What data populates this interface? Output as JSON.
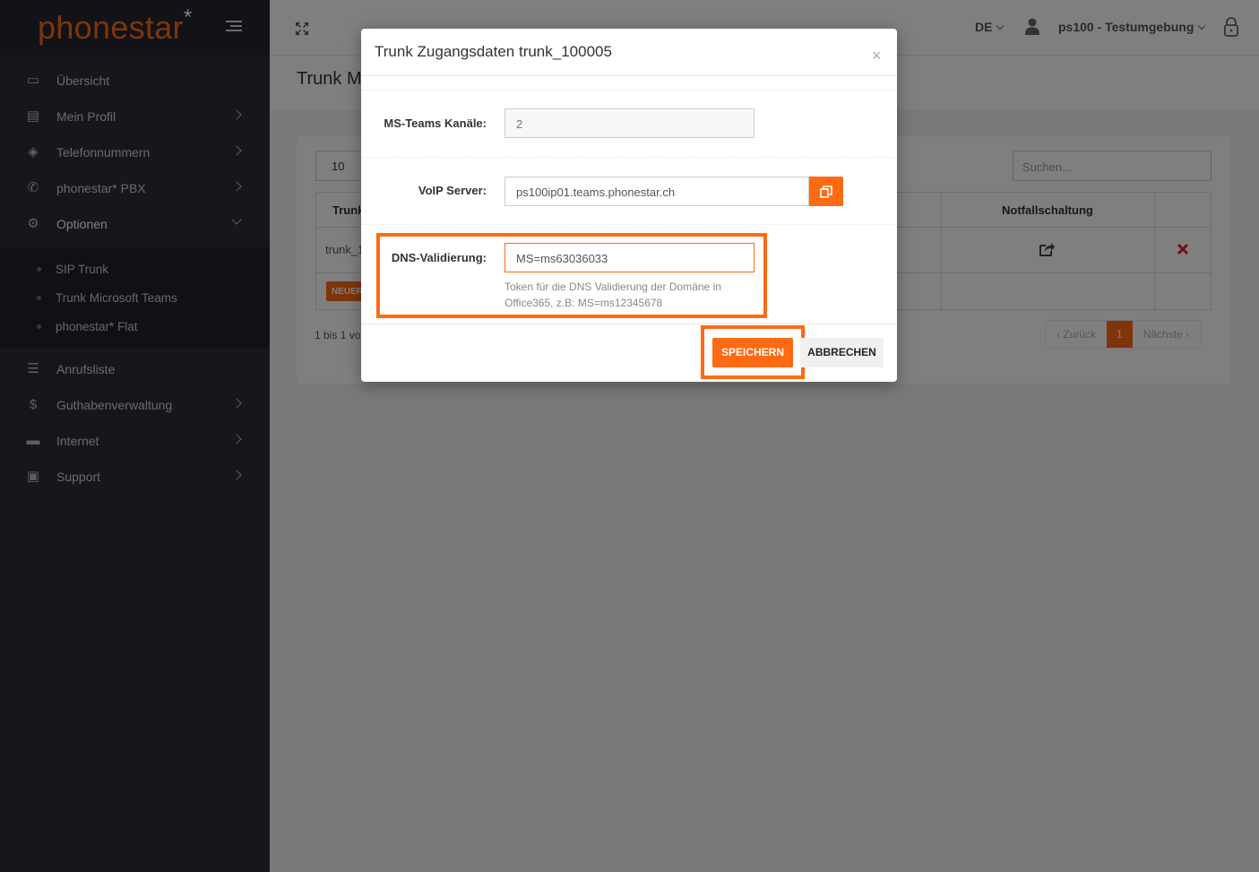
{
  "sidebar": {
    "logo": {
      "text": "phonestar",
      "mark": "*"
    },
    "items": [
      {
        "label": "Übersicht",
        "icon": "dashboard-icon"
      },
      {
        "label": "Mein Profil",
        "icon": "document-icon"
      },
      {
        "label": "Telefonnummern",
        "icon": "tags-icon"
      },
      {
        "label": "phonestar* PBX",
        "icon": "phone-icon"
      },
      {
        "label": "Optionen",
        "icon": "cogs-icon"
      },
      {
        "label": "Anrufsliste",
        "icon": "list-icon"
      },
      {
        "label": "Guthabenverwaltung",
        "icon": "dollar-icon"
      },
      {
        "label": "Internet",
        "icon": "laptop-icon"
      },
      {
        "label": "Support",
        "icon": "briefcase-icon"
      }
    ],
    "subitems": [
      {
        "label": "SIP Trunk"
      },
      {
        "label": "Trunk Microsoft Teams"
      },
      {
        "label": "phonestar* Flat"
      }
    ]
  },
  "header": {
    "lang": "DE",
    "user": "ps100 - Testumgebung"
  },
  "page": {
    "title": "Trunk M",
    "length_value": "10",
    "search_placeholder": "Suchen...",
    "col_trunk": "Trunk",
    "col_notfall": "Notfallschaltung",
    "row_trunk": "trunk_1",
    "new_badge": "NEUER",
    "info": "1 bis 1 vo",
    "pager": {
      "prev": "Zurück",
      "current": "1",
      "next": "Nächste"
    }
  },
  "modal": {
    "title": "Trunk Zugangsdaten trunk_100005",
    "close": "×",
    "fields": {
      "channels_label": "MS-Teams Kanäle:",
      "channels_value": "2",
      "voip_label": "VoIP Server:",
      "voip_value": "ps100ip01.teams.phonestar.ch",
      "dns_label": "DNS-Validierung:",
      "dns_value": "MS=ms63036033",
      "dns_help": "Token für die DNS Validierung der Domäne in Office365, z.B: MS=ms12345678"
    },
    "buttons": {
      "save": "SPEICHERN",
      "cancel": "ABBRECHEN"
    }
  },
  "colors": {
    "accent": "#ff6a13",
    "sidebar": "#2b2f3a"
  }
}
